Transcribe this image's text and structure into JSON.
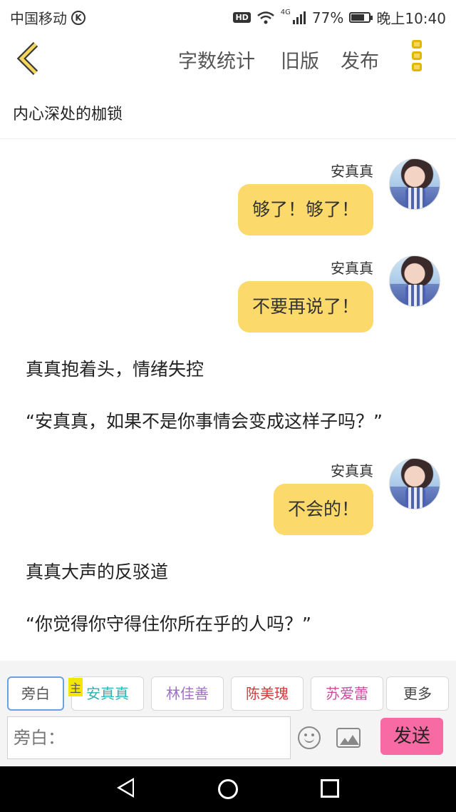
{
  "status_bar": {
    "carrier": "中国移动",
    "carrier_badge": "K",
    "hd": "HD",
    "network": "4G",
    "battery_percent": "77%",
    "battery_level": 0.77,
    "time": "晚上10:40"
  },
  "nav": {
    "word_count": "字数统计",
    "old_version": "旧版",
    "publish": "发布"
  },
  "title": "内心深处的枷锁",
  "messages": [
    {
      "type": "bubble",
      "speaker": "安真真",
      "text": "够了！够了！"
    },
    {
      "type": "bubble",
      "speaker": "安真真",
      "text": "不要再说了！"
    },
    {
      "type": "narration",
      "text": "真真抱着头，情绪失控"
    },
    {
      "type": "narration",
      "text": "“安真真，如果不是你事情会变成这样子吗？”"
    },
    {
      "type": "bubble",
      "speaker": "安真真",
      "text": "不会的！"
    },
    {
      "type": "narration",
      "text": "真真大声的反驳道"
    },
    {
      "type": "narration",
      "text": "“你觉得你守得住你所在乎的人吗？”"
    }
  ],
  "roles": [
    {
      "label": "旁白",
      "color": "#555555"
    },
    {
      "label": "安真真",
      "color": "#2bb3b3"
    },
    {
      "label": "林佳善",
      "color": "#a070c8"
    },
    {
      "label": "陈美瑰",
      "color": "#d23a3a"
    },
    {
      "label": "苏爱蕾",
      "color": "#d048a0"
    },
    {
      "label": "更多",
      "color": "#444444"
    }
  ],
  "host_tag": "主",
  "input": {
    "placeholder": "旁白："
  },
  "send_label": "发送"
}
